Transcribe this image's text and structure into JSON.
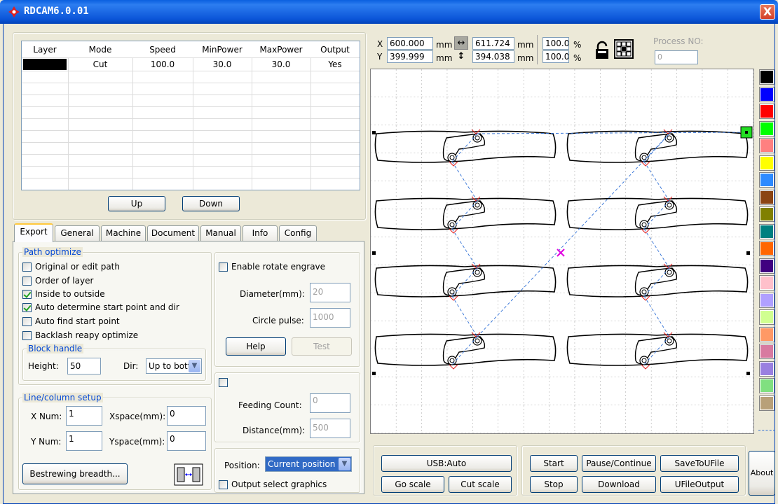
{
  "window": {
    "title": "RDCAM6.0.01",
    "close_label": "X"
  },
  "layer_table": {
    "columns": [
      "Layer",
      "Mode",
      "Speed",
      "MinPower",
      "MaxPower",
      "Output"
    ],
    "rows": [
      {
        "layer_color": "#000000",
        "mode": "Cut",
        "speed": "100.0",
        "min_power": "30.0",
        "max_power": "30.0",
        "output": "Yes"
      }
    ],
    "up_label": "Up",
    "down_label": "Down"
  },
  "tabs": [
    {
      "label": "Export",
      "active": true
    },
    {
      "label": "General"
    },
    {
      "label": "Machine"
    },
    {
      "label": "Document"
    },
    {
      "label": "Manual"
    },
    {
      "label": "Info"
    },
    {
      "label": "Config"
    }
  ],
  "export": {
    "path_optimize": {
      "title": "Path optimize",
      "options": [
        {
          "label": "Original or edit path",
          "checked": false
        },
        {
          "label": "Order of layer",
          "checked": false
        },
        {
          "label": "Inside to outside",
          "checked": true
        },
        {
          "label": "Auto determine start point and dir",
          "checked": true
        },
        {
          "label": "Auto find start point",
          "checked": false
        },
        {
          "label": "Backlash reapy optimize",
          "checked": false
        }
      ]
    },
    "block_handle": {
      "title": "Block handle",
      "height_label": "Height:",
      "height_value": "50",
      "dir_label": "Dir:",
      "dir_value": "Up to bott"
    },
    "line_column": {
      "title": "Line/column setup",
      "xnum_label": "X Num:",
      "xnum_value": "1",
      "xspace_label": "Xspace(mm):",
      "xspace_value": "0",
      "ynum_label": "Y Num:",
      "ynum_value": "1",
      "yspace_label": "Yspace(mm):",
      "yspace_value": "0",
      "bestrewing_label": "Bestrewing breadth..."
    },
    "rotate": {
      "enable_label": "Enable rotate engrave",
      "diameter_label": "Diameter(mm):",
      "diameter_value": "20",
      "circle_label": "Circle pulse:",
      "circle_value": "1000",
      "help_label": "Help",
      "test_label": "Test"
    },
    "feeding": {
      "count_label": "Feeding Count:",
      "count_value": "0",
      "distance_label": "Distance(mm):",
      "distance_value": "500"
    },
    "position": {
      "label": "Position:",
      "value": "Current position",
      "output_select_label": "Output select graphics"
    }
  },
  "coords": {
    "x_label": "X",
    "x_value": "600.000",
    "y_label": "Y",
    "y_value": "399.999",
    "unit": "mm",
    "width_value": "611.724",
    "height_value": "394.038",
    "scale_x": "100.0",
    "scale_y": "100.0",
    "percent": "%",
    "process_label": "Process NO:",
    "process_value": "0"
  },
  "palette": [
    "#000000",
    "#0000ff",
    "#ff0000",
    "#00ff00",
    "#ff8080",
    "#ffff00",
    "#2e8bff",
    "#8b4513",
    "#808000",
    "#008080",
    "#ff6600",
    "#400080",
    "#ffc0cb",
    "#b0a0ff",
    "#d0ff90",
    "#ff9966",
    "#d87aa0",
    "#9a80e0",
    "#80e080",
    "#b8a078"
  ],
  "bottom": {
    "usb_label": "USB:Auto",
    "go_scale_label": "Go scale",
    "cut_scale_label": "Cut scale",
    "start_label": "Start",
    "pause_label": "Pause/Continue",
    "save_label": "SaveToUFile",
    "stop_label": "Stop",
    "download_label": "Download",
    "ufile_label": "UFileOutput",
    "about_label": "About"
  }
}
